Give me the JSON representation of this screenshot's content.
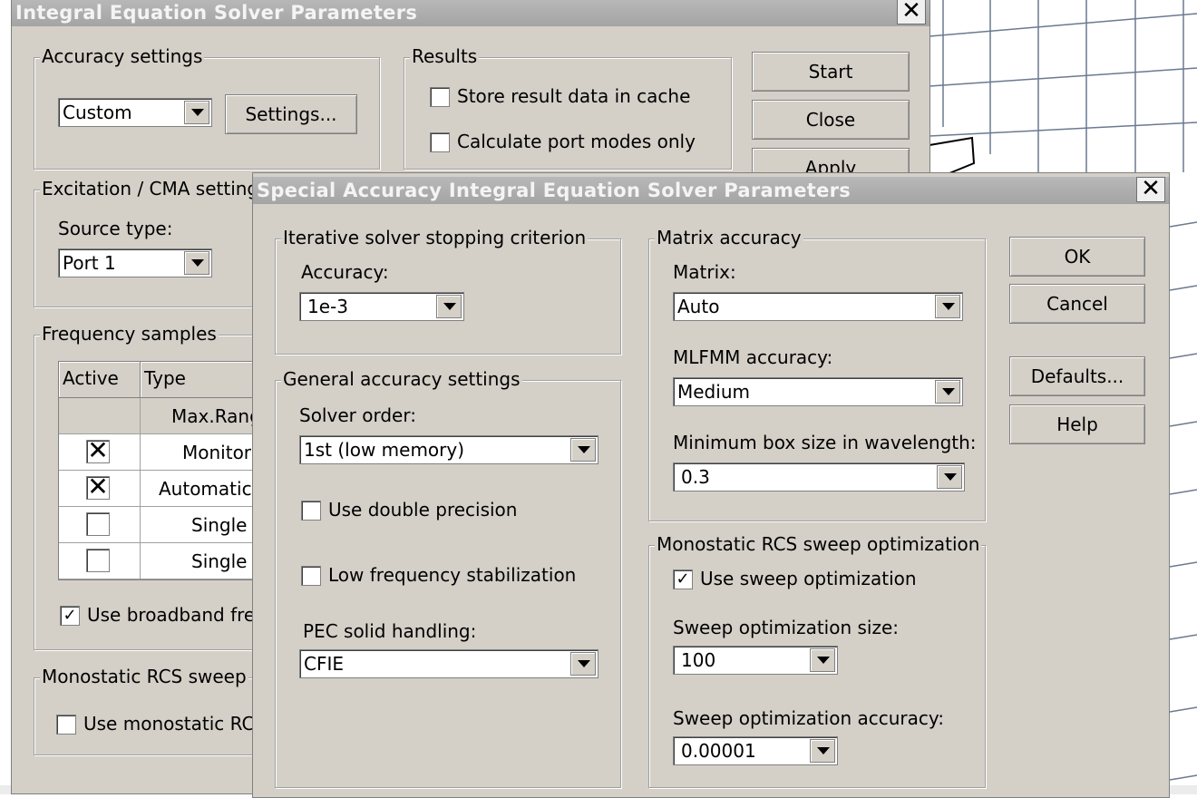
{
  "main_dialog": {
    "title": "Integral Equation Solver Parameters",
    "close_glyph": "✕",
    "accuracy_settings": {
      "title": "Accuracy settings",
      "combo_value": "Custom",
      "settings_button": "Settings..."
    },
    "results": {
      "title": "Results",
      "store_cache_label": "Store result data in cache",
      "store_cache_checked": false,
      "port_modes_label": "Calculate port modes only",
      "port_modes_checked": false
    },
    "buttons": {
      "start": "Start",
      "close": "Close",
      "apply": "Apply"
    },
    "excitation": {
      "title": "Excitation / CMA settings",
      "source_type_label": "Source type:",
      "source_type_value": "Port 1"
    },
    "frequency_samples": {
      "title": "Frequency samples",
      "headers": [
        "Active",
        "Type"
      ],
      "subheader": "Max.Range",
      "rows": [
        {
          "active": true,
          "mark": "✕",
          "type": "Monitors"
        },
        {
          "active": true,
          "mark": "✕",
          "type": "Automatic"
        },
        {
          "active": false,
          "mark": "",
          "type": "Single"
        },
        {
          "active": false,
          "mark": "",
          "type": "Single"
        }
      ],
      "broadband_label": "Use broadband freq",
      "broadband_checked": true,
      "check_glyph": "✓"
    },
    "monostatic": {
      "title": "Monostatic RCS sweep",
      "use_label": "Use monostatic RCS",
      "use_checked": false
    }
  },
  "special_dialog": {
    "title": "Special Accuracy Integral Equation Solver Parameters",
    "close_glyph": "✕",
    "iterative": {
      "title": "Iterative solver stopping criterion",
      "accuracy_label": "Accuracy:",
      "accuracy_value": "1e-3"
    },
    "general": {
      "title": "General accuracy settings",
      "solver_order_label": "Solver order:",
      "solver_order_value": "1st (low memory)",
      "double_precision_label": "Use double precision",
      "double_precision_checked": false,
      "low_freq_label": "Low frequency stabilization",
      "low_freq_checked": false,
      "pec_label": "PEC solid handling:",
      "pec_value": "CFIE"
    },
    "matrix": {
      "title": "Matrix accuracy",
      "matrix_label": "Matrix:",
      "matrix_value": "Auto",
      "mlfmm_label": "MLFMM accuracy:",
      "mlfmm_value": "Medium",
      "min_box_label": "Minimum box size in wavelength:",
      "min_box_value": "0.3"
    },
    "rcs_sweep": {
      "title": "Monostatic RCS sweep optimization",
      "use_label": "Use sweep optimization",
      "use_checked": true,
      "check_glyph": "✓",
      "size_label": "Sweep optimization size:",
      "size_value": "100",
      "accuracy_label": "Sweep optimization accuracy:",
      "accuracy_value": "0.00001"
    },
    "buttons": {
      "ok": "OK",
      "cancel": "Cancel",
      "defaults": "Defaults...",
      "help": "Help"
    }
  }
}
